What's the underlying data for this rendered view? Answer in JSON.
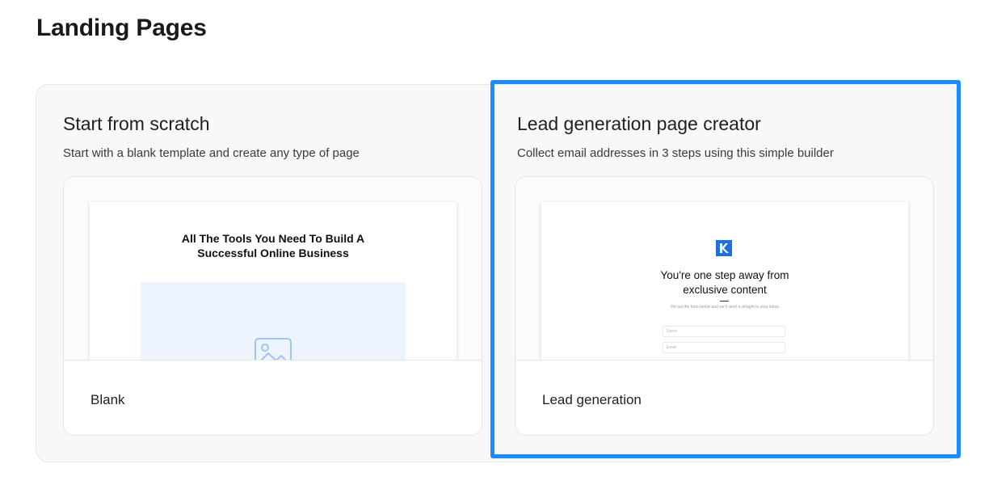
{
  "page": {
    "title": "Landing Pages"
  },
  "options": {
    "scratch": {
      "title": "Start from scratch",
      "description": "Start with a blank template and create any type of page",
      "card_label": "Blank",
      "preview": {
        "heading_line1": "All The Tools You Need To Build A",
        "heading_line2": "Successful Online Business",
        "image_icon": "image-placeholder-icon"
      }
    },
    "lead": {
      "title": "Lead generation page creator",
      "description": "Collect email addresses in 3 steps using this simple builder",
      "card_label": "Lead generation",
      "preview": {
        "logo_icon": "kajabi-logo-icon",
        "heading_line1": "You're one step away from",
        "heading_line2": "exclusive content",
        "subtext": "Fill out the form below and we'll send it straight to your inbox",
        "field_name_placeholder": "Name",
        "field_email_placeholder": "Email"
      }
    }
  },
  "colors": {
    "highlight": "#1a8cff",
    "logo_blue": "#1f6fe0",
    "image_placeholder_bg": "#edf4fd"
  }
}
